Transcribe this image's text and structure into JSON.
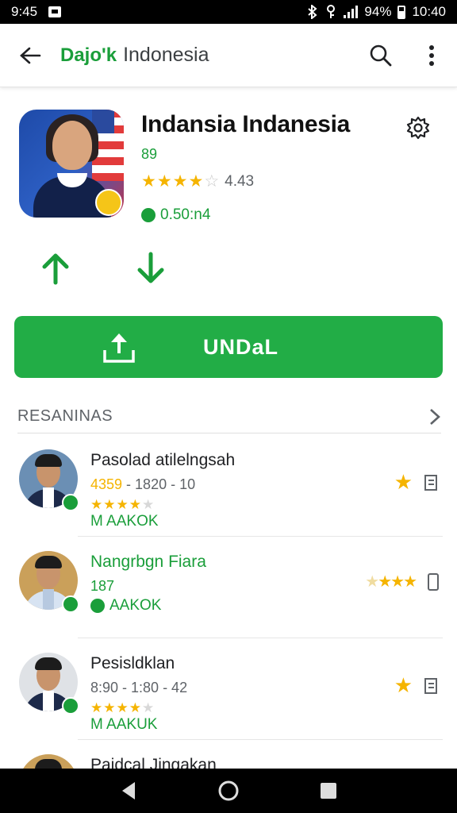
{
  "status_bar": {
    "time": "9:45",
    "battery": "94%",
    "clock": "10:40"
  },
  "app_bar": {
    "logo_text": "Dajo'k",
    "title": "Indonesia"
  },
  "app": {
    "name": "Indansia Indanesia",
    "subtitle": "89",
    "stars": "★★★★",
    "stars_empty": "☆",
    "rating": "4.43",
    "meta": "0.50:n4"
  },
  "install_button": {
    "label": "UNDaL"
  },
  "section": {
    "title": "RESANINAS"
  },
  "list": [
    {
      "name": "Pasolad atilelngsah",
      "sub_highlight": "4359",
      "sub": " - 1820 - 10",
      "stars": "★★★★",
      "stars_empty": "★",
      "tag": "M AAKOK"
    },
    {
      "name": "Nangrbgn Fiara",
      "sub": "187",
      "tag": "AAKOK"
    },
    {
      "name": "Pesisldklan",
      "sub": "8:90 - 1:80 - 42",
      "stars": "★★★★",
      "stars_empty": "★",
      "tag": "M AAKUK"
    },
    {
      "name": "Paidcal Jingakan"
    }
  ],
  "colors": {
    "accent": "#22ad46",
    "brand_green": "#1a9e3a",
    "star": "#f5b400"
  }
}
